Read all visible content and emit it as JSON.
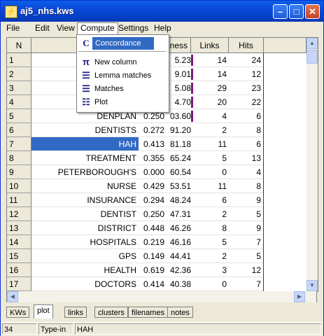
{
  "window": {
    "title": "aj5_nhs.kws"
  },
  "menubar": {
    "items": [
      "File",
      "Edit",
      "View",
      "Compute",
      "Settings",
      "Help"
    ]
  },
  "compute_menu": {
    "items": [
      {
        "label": "Concordance",
        "icon": "concordance-icon",
        "highlighted": true
      },
      {
        "label": "New column",
        "icon": "pi-icon"
      },
      {
        "label": "Lemma matches",
        "icon": "lines-icon"
      },
      {
        "label": "Matches",
        "icon": "lines-icon"
      },
      {
        "label": "Plot",
        "icon": "plot-icon"
      }
    ]
  },
  "table": {
    "headers": {
      "n": "N",
      "keyness": "ness",
      "links": "Links",
      "hits": "Hits"
    },
    "rows": [
      {
        "n": "1",
        "word": "",
        "c1": "",
        "c2": "5.23",
        "links": "14",
        "hits": "24"
      },
      {
        "n": "2",
        "word": "",
        "c1": "",
        "c2": "9.01",
        "links": "14",
        "hits": "12"
      },
      {
        "n": "3",
        "word": "",
        "c1": "",
        "c2": "5.08",
        "links": "29",
        "hits": "23"
      },
      {
        "n": "4",
        "word": "",
        "c1": "",
        "c2": "4.70",
        "links": "20",
        "hits": "22"
      },
      {
        "n": "5",
        "word": "DENPLAN",
        "c1": "0.250",
        "c2": "03.60",
        "links": "4",
        "hits": "6"
      },
      {
        "n": "6",
        "word": "DENTISTS",
        "c1": "0.272",
        "c2": "91.20",
        "links": "2",
        "hits": "8"
      },
      {
        "n": "7",
        "word": "HAH",
        "c1": "0.413",
        "c2": "81.18",
        "links": "11",
        "hits": "6",
        "selected": true
      },
      {
        "n": "8",
        "word": "TREATMENT",
        "c1": "0.355",
        "c2": "65.24",
        "links": "5",
        "hits": "13"
      },
      {
        "n": "9",
        "word": "PETERBOROUGH'S",
        "c1": "0.000",
        "c2": "60.54",
        "links": "0",
        "hits": "4"
      },
      {
        "n": "10",
        "word": "NURSE",
        "c1": "0.429",
        "c2": "53.51",
        "links": "11",
        "hits": "8"
      },
      {
        "n": "11",
        "word": "INSURANCE",
        "c1": "0.294",
        "c2": "48.24",
        "links": "6",
        "hits": "9"
      },
      {
        "n": "12",
        "word": "DENTIST",
        "c1": "0.250",
        "c2": "47.31",
        "links": "2",
        "hits": "5"
      },
      {
        "n": "13",
        "word": "DISTRICT",
        "c1": "0.448",
        "c2": "46.26",
        "links": "8",
        "hits": "9"
      },
      {
        "n": "14",
        "word": "HOSPITALS",
        "c1": "0.219",
        "c2": "46.16",
        "links": "5",
        "hits": "7"
      },
      {
        "n": "15",
        "word": "GPS",
        "c1": "0.149",
        "c2": "44.41",
        "links": "2",
        "hits": "5"
      },
      {
        "n": "16",
        "word": "HEALTH",
        "c1": "0.619",
        "c2": "42.36",
        "links": "3",
        "hits": "12"
      },
      {
        "n": "17",
        "word": "DOCTORS",
        "c1": "0.414",
        "c2": "40.38",
        "links": "0",
        "hits": "7"
      }
    ]
  },
  "tabs": [
    "KWs",
    "plot",
    "links",
    "clusters",
    "filenames",
    "notes"
  ],
  "active_tab": "plot",
  "status": {
    "count": "34",
    "mode": "Type-in",
    "value": "HAH"
  },
  "colors": {
    "titlebar": "#0A48D8",
    "selection": "#316AC5",
    "bar": "#7a1a7a"
  }
}
